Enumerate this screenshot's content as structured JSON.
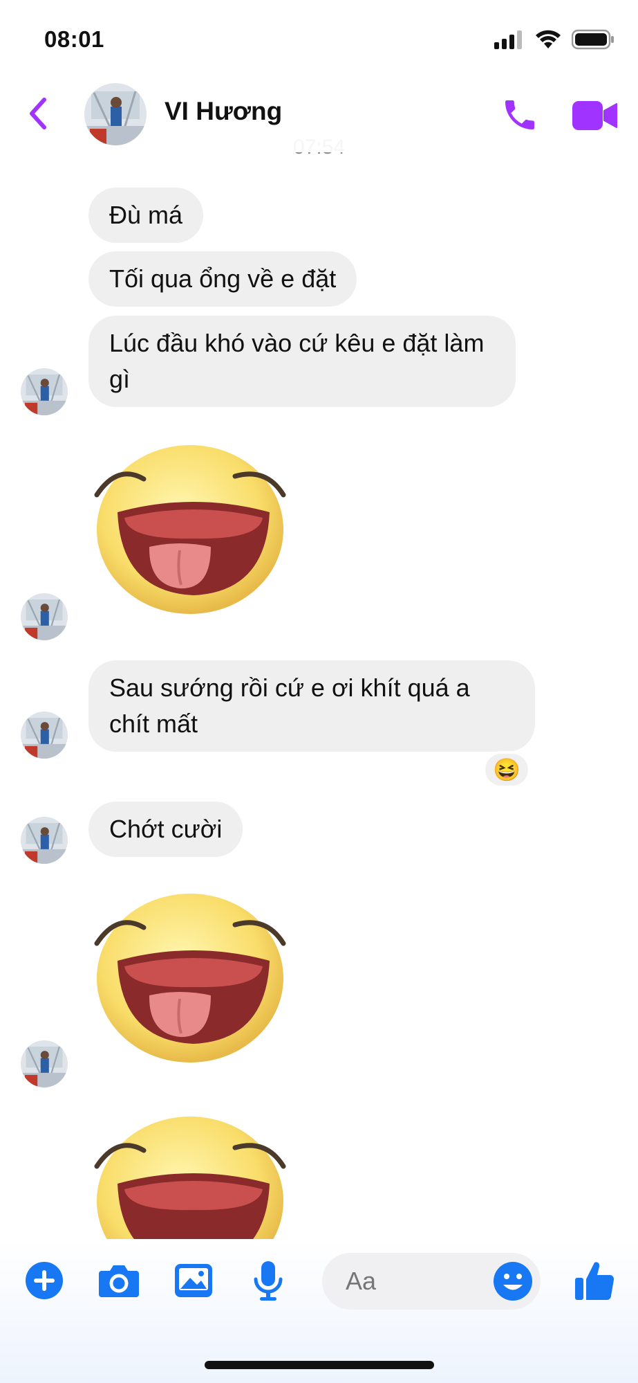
{
  "status_bar": {
    "time": "08:01"
  },
  "header": {
    "contact_name": "VI Hương"
  },
  "timestamp": "07:54",
  "messages": [
    {
      "text": "Đù má"
    },
    {
      "text": "Tối qua ổng về e đặt"
    },
    {
      "text": "Lúc đầu khó vào cứ kêu e đặt làm gì"
    },
    {
      "text": "Sau sướng rồi cứ e ơi khít quá a chít mất",
      "reaction": "😆"
    },
    {
      "text": "Chớt cười"
    }
  ],
  "composer": {
    "placeholder": "Aa"
  },
  "colors": {
    "accent": "#a033ff",
    "blue": "#1877f2",
    "bubble": "#efefef"
  },
  "icons": [
    "back-chevron-icon",
    "phone-icon",
    "video-camera-icon",
    "plus-icon",
    "camera-icon",
    "image-icon",
    "microphone-icon",
    "smiley-icon",
    "thumbs-up-icon"
  ]
}
